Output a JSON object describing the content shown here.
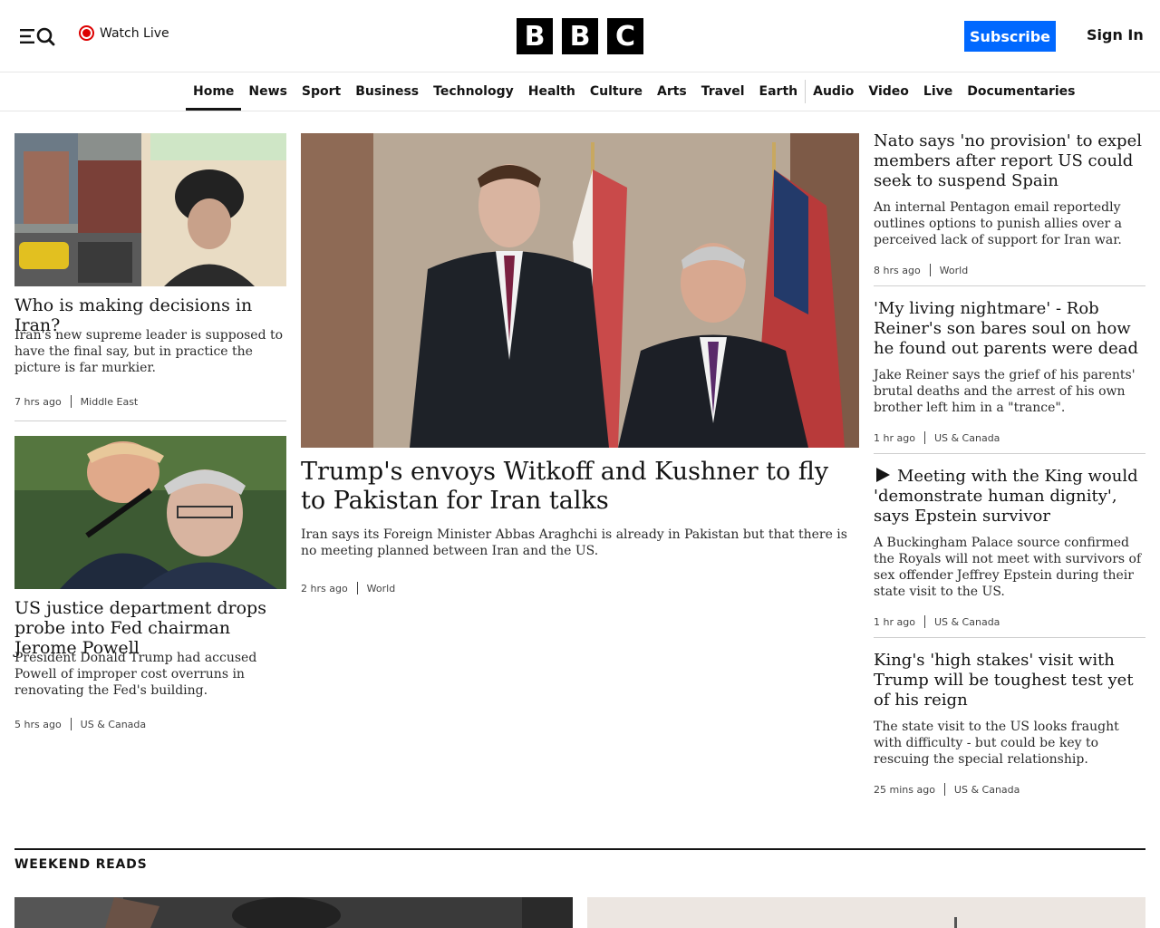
{
  "header": {
    "watch_live": "Watch Live",
    "logo_letters": [
      "B",
      "B",
      "C"
    ],
    "subscribe": "Subscribe",
    "sign_in": "Sign In",
    "accent_color": "#0068ff",
    "live_color": "#dd0000"
  },
  "nav": {
    "items": [
      "Home",
      "News",
      "Sport",
      "Business",
      "Technology",
      "Health",
      "Culture",
      "Arts",
      "Travel",
      "Earth",
      "Audio",
      "Video",
      "Live",
      "Documentaries"
    ],
    "active": "Home"
  },
  "left": [
    {
      "title": "Who is making decisions in Iran?",
      "summary": "Iran's new supreme leader is supposed to have the final say, but in practice the picture is far murkier.",
      "time": "7 hrs ago",
      "section": "Middle East"
    },
    {
      "title": "US justice department drops probe into Fed chairman Jerome Powell",
      "summary": "President Donald Trump had accused Powell of improper cost overruns in renovating the Fed's building.",
      "time": "5 hrs ago",
      "section": "US & Canada"
    }
  ],
  "center": {
    "title": "Trump's envoys Witkoff and Kushner to fly to Pakistan for Iran talks",
    "summary": "Iran says its Foreign Minister Abbas Araghchi is already in Pakistan but that there is no meeting planned between Iran and the US.",
    "time": "2 hrs ago",
    "section": "World"
  },
  "right": [
    {
      "title": "Nato says 'no provision' to expel members after report US could seek to suspend Spain",
      "summary": "An internal Pentagon email reportedly outlines options to punish allies over a perceived lack of support for Iran war.",
      "time": "8 hrs ago",
      "section": "World"
    },
    {
      "title": "'My living nightmare' - Rob Reiner's son bares soul on how he found out parents were dead",
      "summary": "Jake Reiner says the grief of his parents' brutal deaths and the arrest of his own brother left him in a \"trance\".",
      "time": "1 hr ago",
      "section": "US & Canada"
    },
    {
      "title": "Meeting with the King would 'demonstrate human dignity', says Epstein survivor",
      "summary": "A Buckingham Palace source confirmed the Royals will not meet with survivors of sex offender Jeffrey Epstein during their state visit to the US.",
      "time": "1 hr ago",
      "section": "US & Canada",
      "icon": "play-icon"
    },
    {
      "title": "King's 'high stakes' visit with Trump will be toughest test yet of his reign",
      "summary": "The state visit to the US looks fraught with difficulty - but could be key to rescuing the special relationship.",
      "time": "25 mins ago",
      "section": "US & Canada"
    }
  ],
  "weekend": {
    "title": "WEEKEND READS"
  }
}
